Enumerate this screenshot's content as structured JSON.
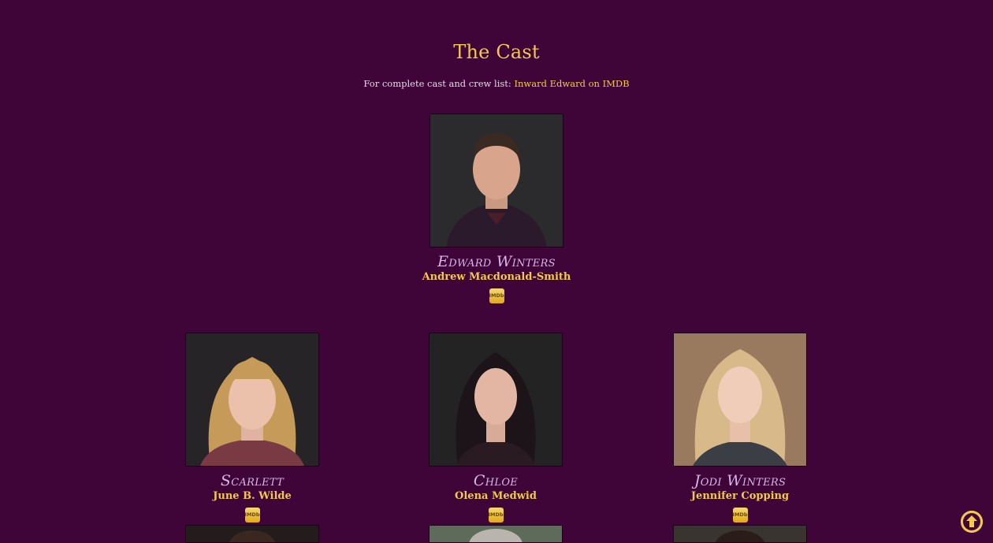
{
  "page": {
    "title": "The Cast",
    "intro_text": "For complete cast and crew list: ",
    "intro_link": "Inward Edward on IMDB"
  },
  "cast": [
    {
      "role": "Edward Winters",
      "actor": "Andrew Macdonald-Smith",
      "badge": "IMDb"
    },
    {
      "role": "Scarlett",
      "actor": "June B. Wilde",
      "badge": "IMDb"
    },
    {
      "role": "Chloe",
      "actor": "Olena Medwid",
      "badge": "IMDb"
    },
    {
      "role": "Jodi Winters",
      "actor": "Jennifer Copping",
      "badge": "IMDb"
    }
  ],
  "colors": {
    "background": "#3f0539",
    "accent": "#f2c94c",
    "role_text": "#d7b6e8"
  },
  "icons": {
    "scroll_top": "arrow-circle-up-icon",
    "imdb": "imdb-badge-icon"
  }
}
